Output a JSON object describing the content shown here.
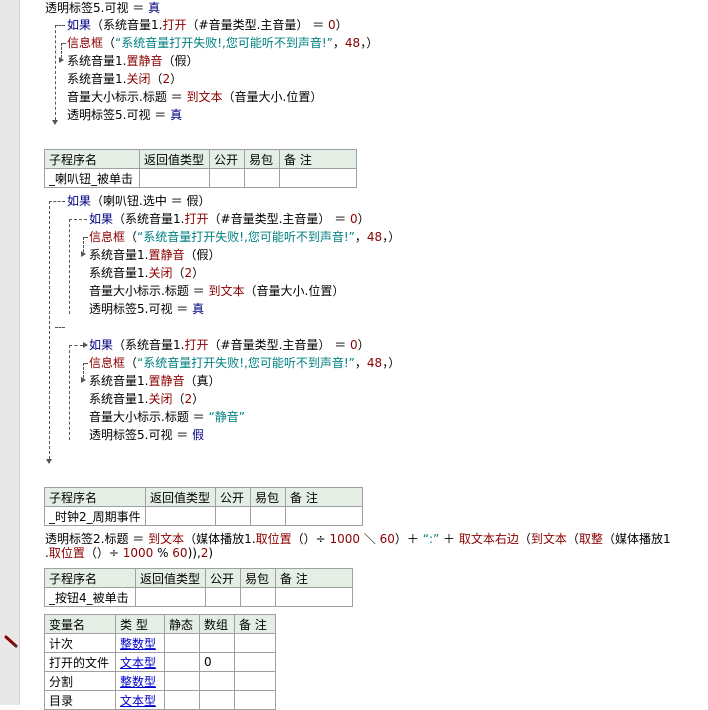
{
  "code": {
    "l1": {
      "obj": "透明标签5",
      "dot": ".",
      "prop": "可视",
      "eq": " ＝ ",
      "val": "真"
    },
    "if1": {
      "kw": "如果",
      "open": "（",
      "obj": "系统音量1",
      "dot": ".",
      "fn": "打开",
      "arg": "（#音量类型.主音量）",
      "cmp": " ＝ ",
      "num": "0",
      "close": "）"
    },
    "msg1": {
      "fn": "信息框",
      "open": "（",
      "str": "“系统音量打开失败!,您可能听不到声音!”",
      "rest": "，",
      "num": "48",
      "close": "，）"
    },
    "mute1": {
      "obj": "系统音量1",
      "dot": ".",
      "fn": "置静音",
      "arg": "（假）"
    },
    "close1": {
      "obj": "系统音量1",
      "dot": ".",
      "fn": "关闭",
      "open": "（",
      "num": "2",
      "close": "）"
    },
    "title1": {
      "obj": "音量大小标示",
      "dot": ".",
      "prop": "标题",
      "eq": " ＝ ",
      "fn": "到文本",
      "arg": "（音量大小.位置）"
    },
    "vis1": {
      "obj": "透明标签5",
      "dot": ".",
      "prop": "可视",
      "eq": " ＝ ",
      "val": "真"
    },
    "if2": {
      "kw": "如果",
      "arg": "（喇叭钮.选中 ＝ 假）"
    },
    "if3": {
      "kw": "如果",
      "open": "（",
      "obj": "系统音量1",
      "dot": ".",
      "fn": "打开",
      "arg": "（#音量类型.主音量）",
      "cmp": " ＝ ",
      "num": "0",
      "close": "）"
    },
    "msg2": {
      "fn": "信息框",
      "open": "（",
      "str": "“系统音量打开失败!,您可能听不到声音!”",
      "rest": "，",
      "num": "48",
      "close": "，）"
    },
    "mute2": {
      "obj": "系统音量1",
      "dot": ".",
      "fn": "置静音",
      "arg": "（假）"
    },
    "close2": {
      "obj": "系统音量1",
      "dot": ".",
      "fn": "关闭",
      "open": "（",
      "num": "2",
      "close": "）"
    },
    "title2": {
      "obj": "音量大小标示",
      "dot": ".",
      "prop": "标题",
      "eq": " ＝ ",
      "fn": "到文本",
      "arg": "（音量大小.位置）"
    },
    "vis2": {
      "obj": "透明标签5",
      "dot": ".",
      "prop": "可视",
      "eq": " ＝ ",
      "val": "真"
    },
    "if4": {
      "kw": "如果",
      "open": "（",
      "obj": "系统音量1",
      "dot": ".",
      "fn": "打开",
      "arg": "（#音量类型.主音量）",
      "cmp": " ＝ ",
      "num": "0",
      "close": "）"
    },
    "msg3": {
      "fn": "信息框",
      "open": "（",
      "str": "“系统音量打开失败!,您可能听不到声音!”",
      "rest": "，",
      "num": "48",
      "close": "，）"
    },
    "mute3": {
      "obj": "系统音量1",
      "dot": ".",
      "fn": "置静音",
      "arg": "（真）"
    },
    "close3": {
      "obj": "系统音量1",
      "dot": ".",
      "fn": "关闭",
      "open": "（",
      "num": "2",
      "close": "）"
    },
    "title3": {
      "obj": "音量大小标示",
      "dot": ".",
      "prop": "标题",
      "eq": " ＝ ",
      "str": "“静音”"
    },
    "vis3": {
      "obj": "透明标签5",
      "dot": ".",
      "prop": "可视",
      "eq": " ＝ ",
      "val": "假"
    },
    "timer": {
      "a": "透明标签2.标题 ＝ ",
      "f1": "到文本",
      "b": "（媒体播放1.",
      "f2": "取位置",
      "c": "（）÷ ",
      "n1": "1000",
      "d": " ＼ ",
      "n2": "60",
      "e": "）＋ ",
      "s1": "“:”",
      "g": " ＋ ",
      "f3": "取文本右边",
      "h": "（",
      "f4": "到文本",
      "i": "（",
      "f5": "取整",
      "j": "（媒体播放1",
      "k": ".",
      "f6": "取位置",
      "l": "（）÷ ",
      "n3": "1000",
      "m": " % ",
      "n4": "60",
      "o": ")),",
      "n5": "2",
      "p": ")"
    }
  },
  "sub_tables": [
    {
      "headers": [
        "子程序名",
        "返回值类型",
        "公开",
        "易包",
        "备 注"
      ],
      "name": "_喇叭钮_被单击"
    },
    {
      "headers": [
        "子程序名",
        "返回值类型",
        "公开",
        "易包",
        "备 注"
      ],
      "name": "_时钟2_周期事件"
    },
    {
      "headers": [
        "子程序名",
        "返回值类型",
        "公开",
        "易包",
        "备 注"
      ],
      "name": "_按钮4_被单击"
    }
  ],
  "var_table": {
    "headers": [
      "变量名",
      "类 型",
      "静态",
      "数组",
      "备 注"
    ],
    "rows": [
      {
        "name": "计次",
        "type": "整数型",
        "static": "",
        "array": "",
        "note": ""
      },
      {
        "name": "打开的文件",
        "type": "文本型",
        "static": "",
        "array": "0",
        "note": ""
      },
      {
        "name": "分割",
        "type": "整数型",
        "static": "",
        "array": "",
        "note": ""
      },
      {
        "name": "目录",
        "type": "文本型",
        "static": "",
        "array": "",
        "note": ""
      }
    ]
  },
  "icons": [
    "breakpoint-pencil-icon",
    "flow-arrow-icon"
  ]
}
